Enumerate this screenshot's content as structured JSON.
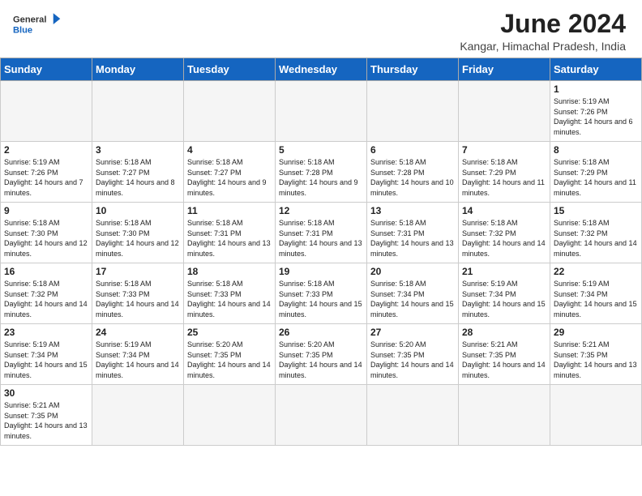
{
  "header": {
    "logo_general": "General",
    "logo_blue": "Blue",
    "month_title": "June 2024",
    "location": "Kangar, Himachal Pradesh, India"
  },
  "weekdays": [
    "Sunday",
    "Monday",
    "Tuesday",
    "Wednesday",
    "Thursday",
    "Friday",
    "Saturday"
  ],
  "weeks": [
    [
      {
        "day": "",
        "empty": true
      },
      {
        "day": "",
        "empty": true
      },
      {
        "day": "",
        "empty": true
      },
      {
        "day": "",
        "empty": true
      },
      {
        "day": "",
        "empty": true
      },
      {
        "day": "",
        "empty": true
      },
      {
        "day": "1",
        "sunrise": "5:19 AM",
        "sunset": "7:26 PM",
        "daylight": "14 hours and 6 minutes."
      }
    ],
    [
      {
        "day": "2",
        "sunrise": "5:19 AM",
        "sunset": "7:26 PM",
        "daylight": "14 hours and 7 minutes."
      },
      {
        "day": "3",
        "sunrise": "5:18 AM",
        "sunset": "7:27 PM",
        "daylight": "14 hours and 8 minutes."
      },
      {
        "day": "4",
        "sunrise": "5:18 AM",
        "sunset": "7:27 PM",
        "daylight": "14 hours and 9 minutes."
      },
      {
        "day": "5",
        "sunrise": "5:18 AM",
        "sunset": "7:28 PM",
        "daylight": "14 hours and 9 minutes."
      },
      {
        "day": "6",
        "sunrise": "5:18 AM",
        "sunset": "7:28 PM",
        "daylight": "14 hours and 10 minutes."
      },
      {
        "day": "7",
        "sunrise": "5:18 AM",
        "sunset": "7:29 PM",
        "daylight": "14 hours and 11 minutes."
      },
      {
        "day": "8",
        "sunrise": "5:18 AM",
        "sunset": "7:29 PM",
        "daylight": "14 hours and 11 minutes."
      }
    ],
    [
      {
        "day": "9",
        "sunrise": "5:18 AM",
        "sunset": "7:30 PM",
        "daylight": "14 hours and 12 minutes."
      },
      {
        "day": "10",
        "sunrise": "5:18 AM",
        "sunset": "7:30 PM",
        "daylight": "14 hours and 12 minutes."
      },
      {
        "day": "11",
        "sunrise": "5:18 AM",
        "sunset": "7:31 PM",
        "daylight": "14 hours and 13 minutes."
      },
      {
        "day": "12",
        "sunrise": "5:18 AM",
        "sunset": "7:31 PM",
        "daylight": "14 hours and 13 minutes."
      },
      {
        "day": "13",
        "sunrise": "5:18 AM",
        "sunset": "7:31 PM",
        "daylight": "14 hours and 13 minutes."
      },
      {
        "day": "14",
        "sunrise": "5:18 AM",
        "sunset": "7:32 PM",
        "daylight": "14 hours and 14 minutes."
      },
      {
        "day": "15",
        "sunrise": "5:18 AM",
        "sunset": "7:32 PM",
        "daylight": "14 hours and 14 minutes."
      }
    ],
    [
      {
        "day": "16",
        "sunrise": "5:18 AM",
        "sunset": "7:32 PM",
        "daylight": "14 hours and 14 minutes."
      },
      {
        "day": "17",
        "sunrise": "5:18 AM",
        "sunset": "7:33 PM",
        "daylight": "14 hours and 14 minutes."
      },
      {
        "day": "18",
        "sunrise": "5:18 AM",
        "sunset": "7:33 PM",
        "daylight": "14 hours and 14 minutes."
      },
      {
        "day": "19",
        "sunrise": "5:18 AM",
        "sunset": "7:33 PM",
        "daylight": "14 hours and 15 minutes."
      },
      {
        "day": "20",
        "sunrise": "5:18 AM",
        "sunset": "7:34 PM",
        "daylight": "14 hours and 15 minutes."
      },
      {
        "day": "21",
        "sunrise": "5:19 AM",
        "sunset": "7:34 PM",
        "daylight": "14 hours and 15 minutes."
      },
      {
        "day": "22",
        "sunrise": "5:19 AM",
        "sunset": "7:34 PM",
        "daylight": "14 hours and 15 minutes."
      }
    ],
    [
      {
        "day": "23",
        "sunrise": "5:19 AM",
        "sunset": "7:34 PM",
        "daylight": "14 hours and 15 minutes."
      },
      {
        "day": "24",
        "sunrise": "5:19 AM",
        "sunset": "7:34 PM",
        "daylight": "14 hours and 14 minutes."
      },
      {
        "day": "25",
        "sunrise": "5:20 AM",
        "sunset": "7:35 PM",
        "daylight": "14 hours and 14 minutes."
      },
      {
        "day": "26",
        "sunrise": "5:20 AM",
        "sunset": "7:35 PM",
        "daylight": "14 hours and 14 minutes."
      },
      {
        "day": "27",
        "sunrise": "5:20 AM",
        "sunset": "7:35 PM",
        "daylight": "14 hours and 14 minutes."
      },
      {
        "day": "28",
        "sunrise": "5:21 AM",
        "sunset": "7:35 PM",
        "daylight": "14 hours and 14 minutes."
      },
      {
        "day": "29",
        "sunrise": "5:21 AM",
        "sunset": "7:35 PM",
        "daylight": "14 hours and 13 minutes."
      }
    ],
    [
      {
        "day": "30",
        "sunrise": "5:21 AM",
        "sunset": "7:35 PM",
        "daylight": "14 hours and 13 minutes."
      },
      {
        "day": "",
        "empty": true
      },
      {
        "day": "",
        "empty": true
      },
      {
        "day": "",
        "empty": true
      },
      {
        "day": "",
        "empty": true
      },
      {
        "day": "",
        "empty": true
      },
      {
        "day": "",
        "empty": true
      }
    ]
  ],
  "labels": {
    "sunrise": "Sunrise:",
    "sunset": "Sunset:",
    "daylight": "Daylight:"
  }
}
